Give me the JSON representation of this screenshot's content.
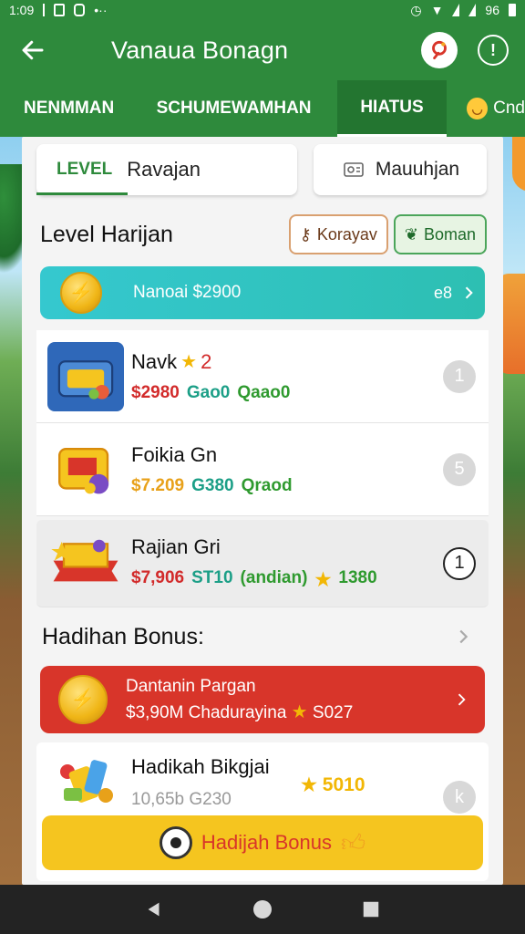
{
  "status_bar": {
    "time": "1:09",
    "battery": "96"
  },
  "app_bar": {
    "title": "Vanaua Bonagn"
  },
  "tabs": [
    {
      "label": "NENMMAN"
    },
    {
      "label": "SCHUMEWAMHAN"
    },
    {
      "label": "HIATUS"
    },
    {
      "label": "Cnd"
    }
  ],
  "top_row": {
    "level_label": "LEVEL",
    "level_value": "Ravajan",
    "secondary_label": "Mauuhjan"
  },
  "section": {
    "title": "Level Harijan",
    "chip_a": "Korayav",
    "chip_b": "Boman"
  },
  "balance": {
    "text": "Nanoai $2900",
    "count": "e8"
  },
  "items": [
    {
      "name": "Navk",
      "star_value": "2",
      "price": "$2980",
      "code": "Gao0",
      "tag": "Qaao0",
      "badge": "1"
    },
    {
      "name": "Foikia Gn",
      "price": "$7.209",
      "code": "G380",
      "tag": "Qraod",
      "badge": "5"
    },
    {
      "name": "Rajian Gri",
      "price": "$7,906",
      "code": "ST10",
      "tag": "(andian)",
      "extra": "1380",
      "badge": "1"
    }
  ],
  "bonus": {
    "title": "Hadihan Bonus:"
  },
  "promo": {
    "line1": "Dantanin Pargan",
    "line2_prefix": "$3,90M Chadurayina",
    "line2_points": "S027"
  },
  "gift": {
    "name": "Hadikah Bikgjai",
    "points": "5010",
    "meta": "10,65b G230",
    "badge": "k",
    "button_label": "Hadijah Bonus"
  },
  "colors": {
    "primary_green": "#2e8a3c",
    "teal": "#35c8cf",
    "red": "#d8352a",
    "yellow": "#f5c51f"
  }
}
